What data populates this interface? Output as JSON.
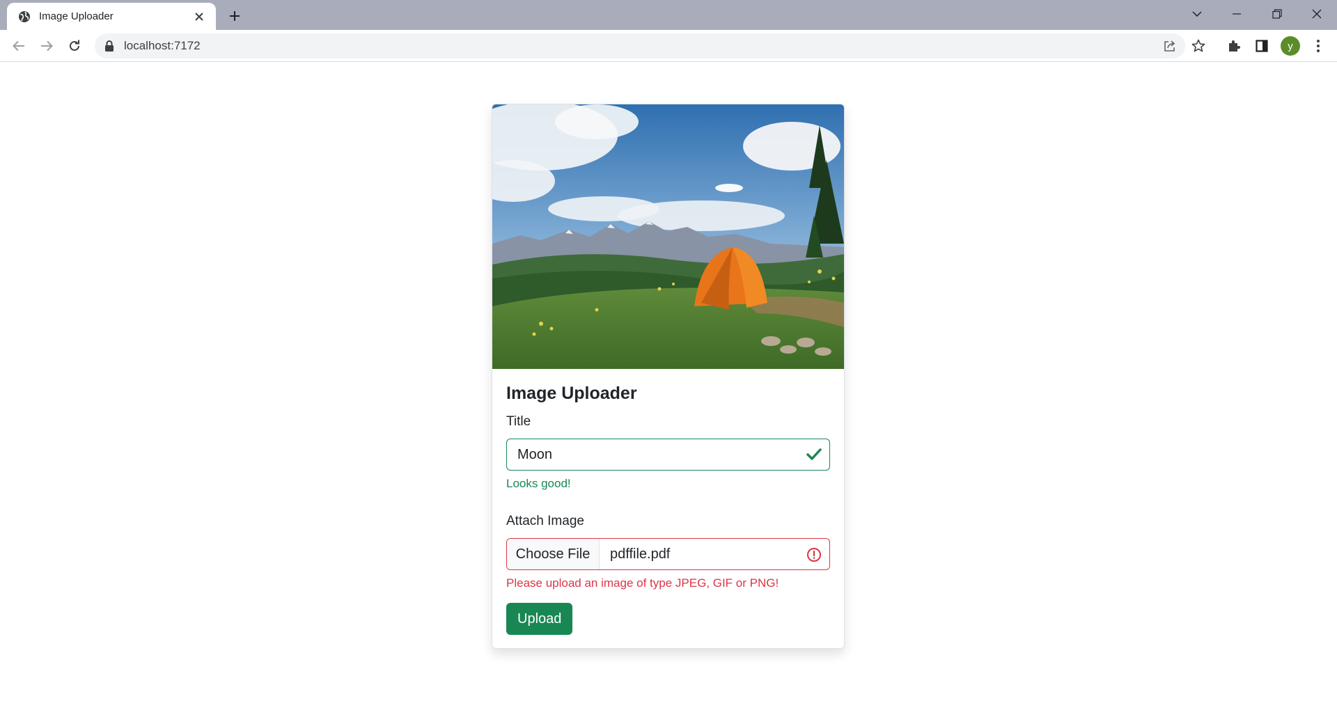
{
  "browser": {
    "tab_title": "Image Uploader",
    "url": "localhost:7172",
    "profile_initial": "y",
    "tabbar_color": "#a9adbb",
    "icons": [
      "globe-icon",
      "close-icon",
      "plus-icon",
      "chevron-down-icon",
      "minimize-icon",
      "restore-icon",
      "window-close-icon",
      "back-arrow-icon",
      "forward-arrow-icon",
      "reload-icon",
      "lock-icon",
      "share-icon",
      "star-icon",
      "extensions-icon",
      "side-panel-icon",
      "menu-dots-icon"
    ]
  },
  "card": {
    "title": "Image Uploader",
    "image_description_hidden": "",
    "title_field": {
      "label": "Title",
      "value": "Moon",
      "feedback": "Looks good!"
    },
    "file_field": {
      "label": "Attach Image",
      "button_label": "Choose File",
      "file_name": "pdffile.pdf",
      "feedback": "Please upload an image of type JPEG, GIF or PNG!"
    },
    "upload_label": "Upload",
    "colors": {
      "valid": "#198754",
      "invalid": "#dc3545",
      "button": "#198754"
    }
  }
}
